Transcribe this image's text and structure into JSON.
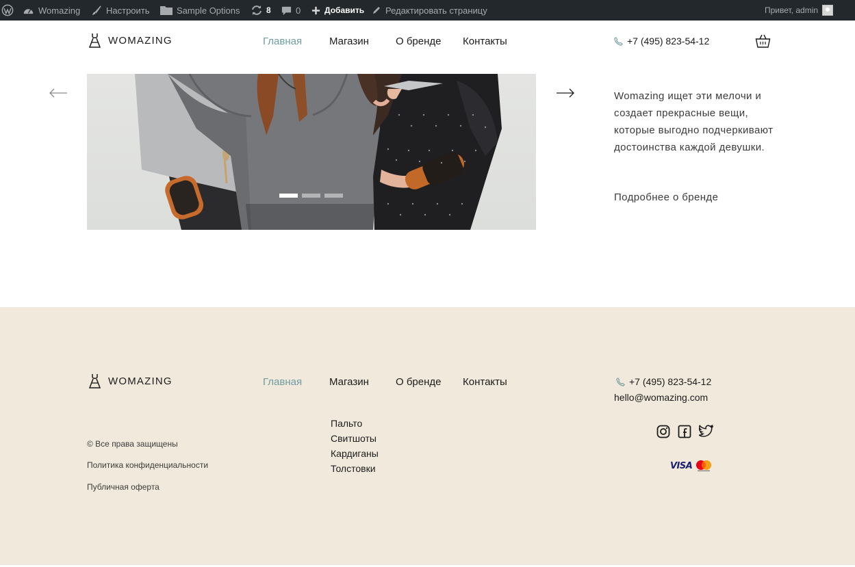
{
  "admin_bar": {
    "site_name": "Womazing",
    "customize": "Настроить",
    "sample_options": "Sample Options",
    "updates_count": "8",
    "comments_count": "0",
    "add_new": "Добавить",
    "edit_page": "Редактировать страницу",
    "greeting": "Привет, admin"
  },
  "header": {
    "logo_text": "WOMAZING",
    "nav": [
      {
        "label": "Главная",
        "active": true
      },
      {
        "label": "Магазин",
        "active": false
      },
      {
        "label": "О бренде",
        "active": false
      },
      {
        "label": "Контакты",
        "active": false
      }
    ],
    "phone": "+7 (495) 823-54-12"
  },
  "slider": {
    "slide_count": 3,
    "active_slide": 1
  },
  "promo": {
    "text": "Womazing ищет эти мелочи и создает прекрасные вещи, которые выгодно подчеркивают достоинства каждой девушки.",
    "link": "Подробнее о бренде"
  },
  "footer": {
    "logo_text": "WOMAZING",
    "nav": [
      {
        "label": "Главная",
        "active": true
      },
      {
        "label": "Магазин",
        "active": false
      },
      {
        "label": "О бренде",
        "active": false
      },
      {
        "label": "Контакты",
        "active": false
      }
    ],
    "categories": [
      "Пальто",
      "Свитшоты",
      "Кардиганы",
      "Толстовки"
    ],
    "copyright": "© Все права защищены",
    "privacy": "Политика конфиденциальности",
    "offer": "Публичная оферта",
    "phone": "+7 (495) 823-54-12",
    "email": "hello@womazing.com",
    "payment_visa": "VISA"
  },
  "colors": {
    "accent": "#6e9c9f",
    "admin_bar": "#23282d",
    "footer_bg": "#f1eadc"
  }
}
